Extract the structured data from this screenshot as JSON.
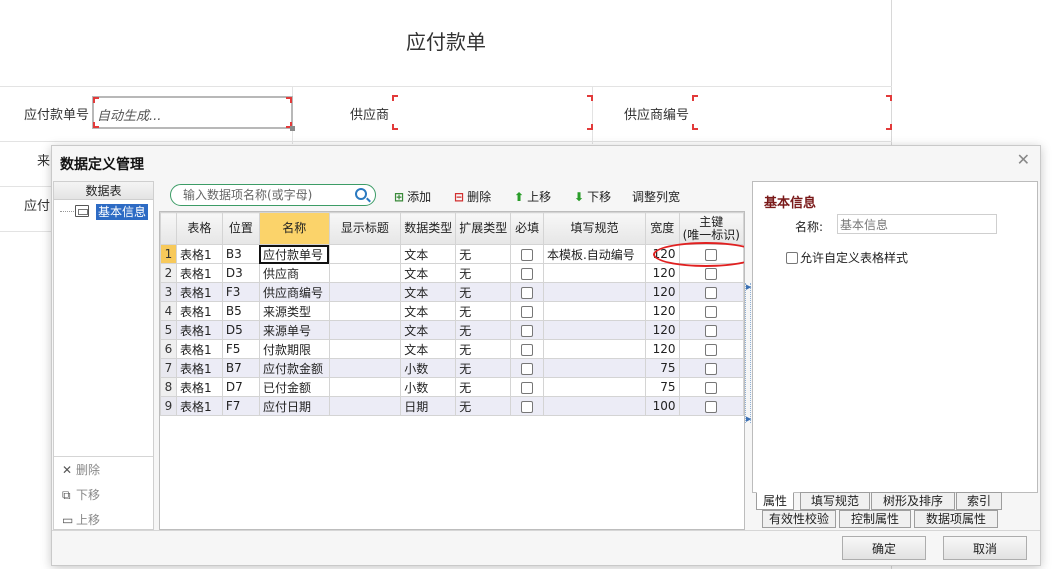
{
  "background_form": {
    "title": "应付款单",
    "fields": [
      {
        "label": "应付款单号",
        "value": "自动生成..."
      },
      {
        "label": "供应商",
        "value": ""
      },
      {
        "label": "供应商编号",
        "value": ""
      }
    ],
    "partial_labels": [
      "来",
      "应付"
    ]
  },
  "dialog": {
    "title": "数据定义管理",
    "left_panel": {
      "header": "数据表",
      "tree_item": "基本信息",
      "actions": {
        "delete": "删除",
        "move_down": "下移",
        "move_up": "上移"
      }
    },
    "toolbar": {
      "search_placeholder": "输入数据项名称(或字母)",
      "add": "添加",
      "delete": "删除",
      "move_up": "上移",
      "move_down": "下移",
      "adjust_width": "调整列宽"
    },
    "grid": {
      "columns": [
        "表格",
        "位置",
        "名称",
        "显示标题",
        "数据类型",
        "扩展类型",
        "必填",
        "填写规范",
        "宽度",
        "主键",
        "(唯一标识)"
      ],
      "rows": [
        {
          "n": "1",
          "table": "表格1",
          "pos": "B3",
          "name": "应付款单号",
          "title": "",
          "type": "文本",
          "ext": "无",
          "rule": "本模板.自动编号",
          "width": "120"
        },
        {
          "n": "2",
          "table": "表格1",
          "pos": "D3",
          "name": "供应商",
          "title": "",
          "type": "文本",
          "ext": "无",
          "rule": "",
          "width": "120"
        },
        {
          "n": "3",
          "table": "表格1",
          "pos": "F3",
          "name": "供应商编号",
          "title": "",
          "type": "文本",
          "ext": "无",
          "rule": "",
          "width": "120"
        },
        {
          "n": "4",
          "table": "表格1",
          "pos": "B5",
          "name": "来源类型",
          "title": "",
          "type": "文本",
          "ext": "无",
          "rule": "",
          "width": "120"
        },
        {
          "n": "5",
          "table": "表格1",
          "pos": "D5",
          "name": "来源单号",
          "title": "",
          "type": "文本",
          "ext": "无",
          "rule": "",
          "width": "120"
        },
        {
          "n": "6",
          "table": "表格1",
          "pos": "F5",
          "name": "付款期限",
          "title": "",
          "type": "文本",
          "ext": "无",
          "rule": "",
          "width": "120"
        },
        {
          "n": "7",
          "table": "表格1",
          "pos": "B7",
          "name": "应付款金额",
          "title": "",
          "type": "小数",
          "ext": "无",
          "rule": "",
          "width": "75"
        },
        {
          "n": "8",
          "table": "表格1",
          "pos": "D7",
          "name": "已付金额",
          "title": "",
          "type": "小数",
          "ext": "无",
          "rule": "",
          "width": "75"
        },
        {
          "n": "9",
          "table": "表格1",
          "pos": "F7",
          "name": "应付日期",
          "title": "",
          "type": "日期",
          "ext": "无",
          "rule": "",
          "width": "100"
        }
      ]
    },
    "right_panel": {
      "heading": "基本信息",
      "name_label": "名称:",
      "name_value": "基本信息",
      "custom_style_label": "允许自定义表格样式",
      "tabs_row1": [
        "属性",
        "填写规范",
        "树形及排序",
        "索引"
      ],
      "tabs_row2": [
        "有效性校验",
        "控制属性",
        "数据项属性"
      ]
    },
    "buttons": {
      "ok": "确定",
      "cancel": "取消"
    }
  }
}
